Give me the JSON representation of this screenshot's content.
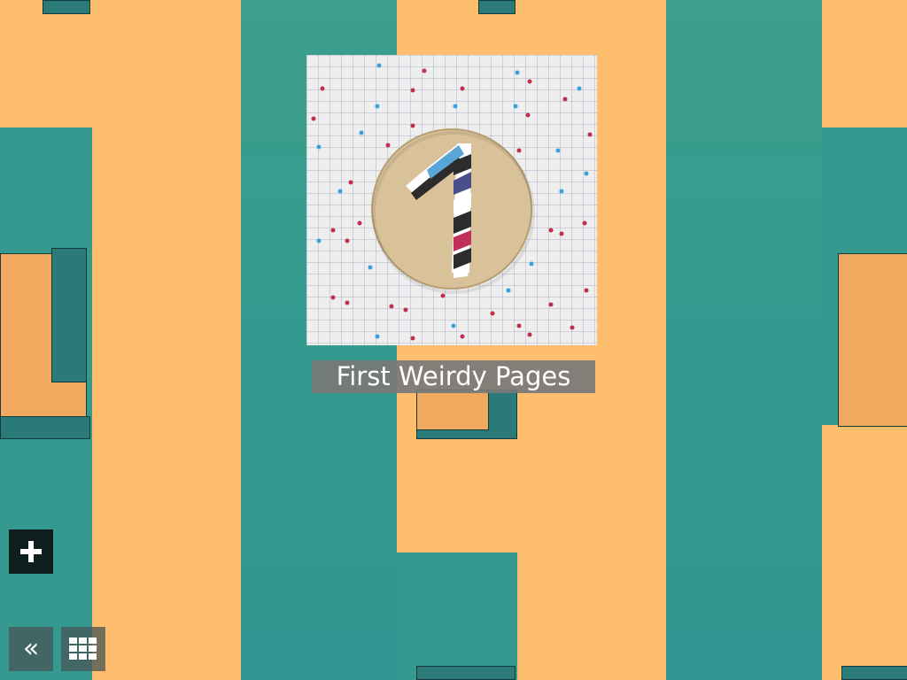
{
  "background": {
    "colors": {
      "orange": "#ffbd6e",
      "teal": "#36998f",
      "outline": "#163a3a"
    }
  },
  "gallery": {
    "items": [
      {
        "title": "First Weirdy Pages",
        "thumbnail_icon": "candy-number-one-icon"
      }
    ]
  },
  "controls": {
    "add": {
      "icon": "plus-icon"
    },
    "back": {
      "icon": "double-chevron-left-icon",
      "glyph": "«"
    },
    "grid": {
      "icon": "grid-icon"
    }
  }
}
